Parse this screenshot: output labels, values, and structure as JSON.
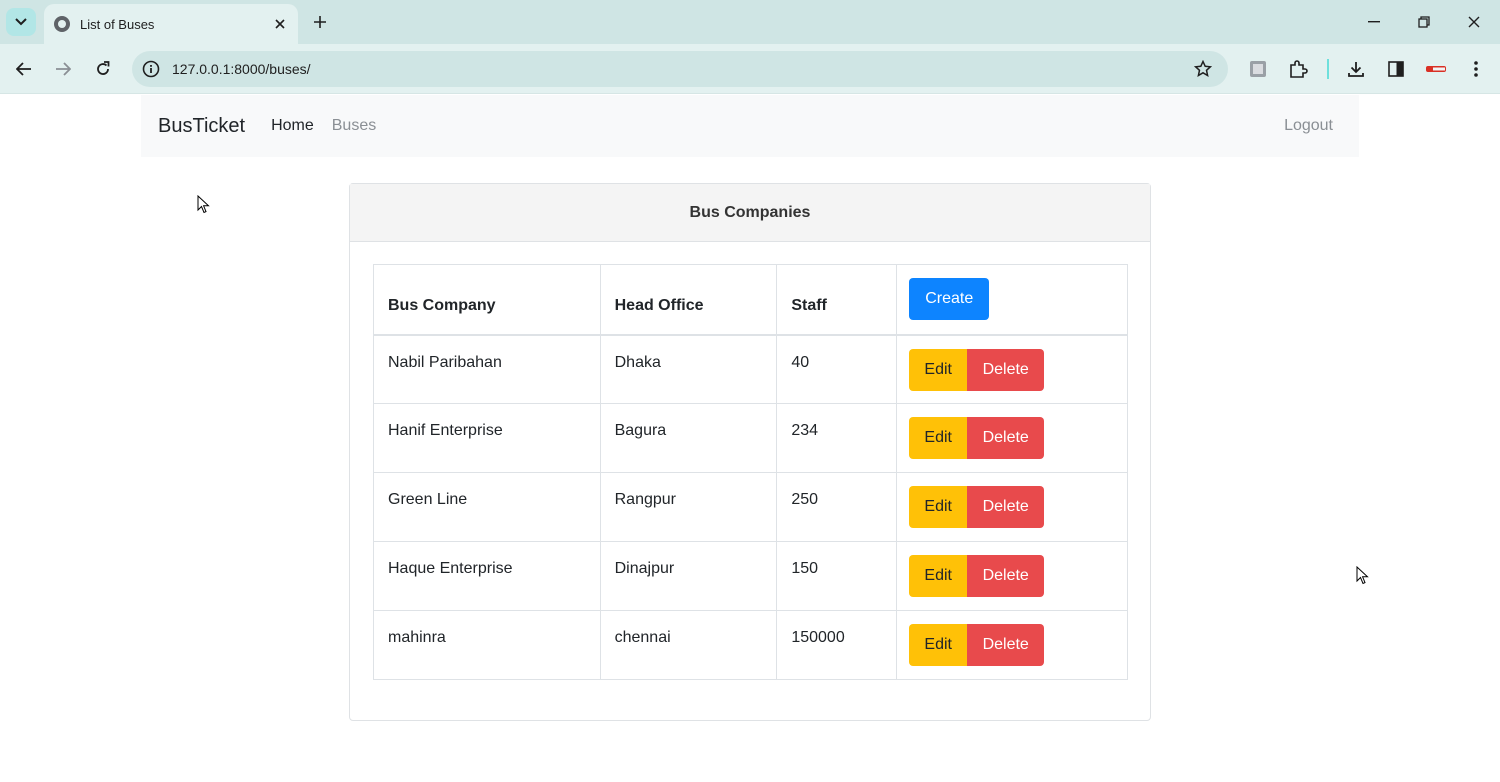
{
  "browser": {
    "tab_title": "List of Buses",
    "url": "127.0.0.1:8000/buses/"
  },
  "navbar": {
    "brand": "BusTicket",
    "links": [
      "Home",
      "Buses"
    ],
    "logout": "Logout"
  },
  "card": {
    "header": "Bus Companies"
  },
  "table": {
    "columns": [
      "Bus Company",
      "Head Office",
      "Staff"
    ],
    "create_label": "Create",
    "edit_label": "Edit",
    "delete_label": "Delete",
    "rows": [
      {
        "company": "Nabil Paribahan",
        "office": "Dhaka",
        "staff": "40"
      },
      {
        "company": "Hanif Enterprise",
        "office": "Bagura",
        "staff": "234"
      },
      {
        "company": "Green Line",
        "office": "Rangpur",
        "staff": "250"
      },
      {
        "company": "Haque Enterprise",
        "office": "Dinajpur",
        "staff": "150"
      },
      {
        "company": "mahinra",
        "office": "chennai",
        "staff": "150000"
      }
    ]
  },
  "colors": {
    "create": "#0d84ff",
    "edit": "#ffc107",
    "delete": "#e84a4c"
  }
}
